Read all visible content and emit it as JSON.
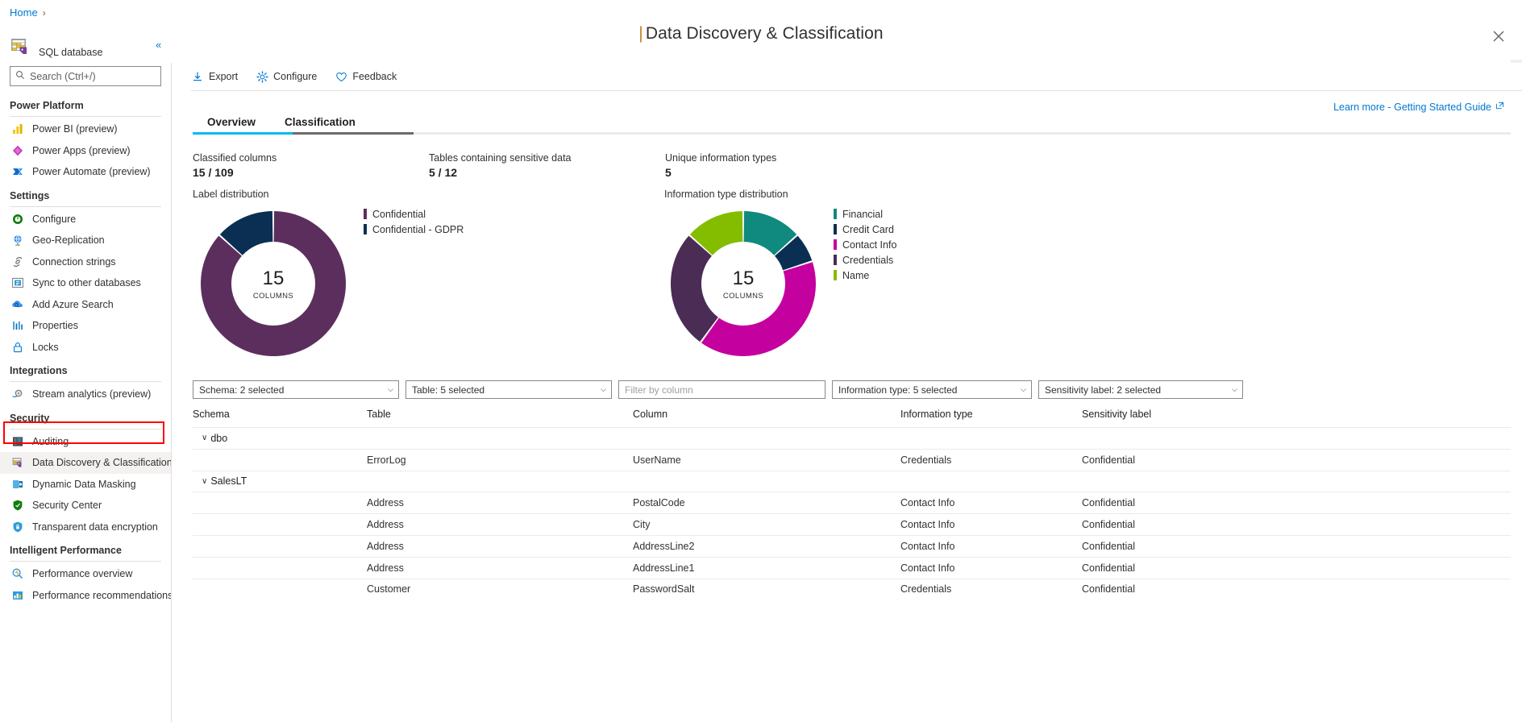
{
  "breadcrumb": {
    "home": "Home",
    "separator": "›"
  },
  "header": {
    "title": "Data Discovery & Classification",
    "title_pipe": "|",
    "close_icon": "close-icon"
  },
  "sidebar": {
    "resource_type": "SQL database",
    "resource_icon": "sql-database-icon",
    "search": {
      "placeholder": "Search (Ctrl+/)",
      "value": "",
      "icon": "search-icon"
    },
    "collapse_icon": "«",
    "groups": [
      {
        "title": "Power Platform",
        "items": [
          {
            "label": "Power BI (preview)",
            "icon": "power-bi-icon",
            "selected": false
          },
          {
            "label": "Power Apps (preview)",
            "icon": "power-apps-icon",
            "selected": false
          },
          {
            "label": "Power Automate (preview)",
            "icon": "power-automate-icon",
            "selected": false
          }
        ]
      },
      {
        "title": "Settings",
        "items": [
          {
            "label": "Configure",
            "icon": "configure-icon",
            "selected": false
          },
          {
            "label": "Geo-Replication",
            "icon": "globe-icon",
            "selected": false
          },
          {
            "label": "Connection strings",
            "icon": "plug-icon",
            "selected": false
          },
          {
            "label": "Sync to other databases",
            "icon": "sync-icon",
            "selected": false
          },
          {
            "label": "Add Azure Search",
            "icon": "cloud-search-icon",
            "selected": false
          },
          {
            "label": "Properties",
            "icon": "properties-icon",
            "selected": false
          },
          {
            "label": "Locks",
            "icon": "lock-icon",
            "selected": false
          }
        ]
      },
      {
        "title": "Integrations",
        "items": [
          {
            "label": "Stream analytics (preview)",
            "icon": "stream-analytics-icon",
            "selected": false
          }
        ]
      },
      {
        "title": "Security",
        "items": [
          {
            "label": "Auditing",
            "icon": "auditing-icon",
            "selected": false
          },
          {
            "label": "Data Discovery & Classification",
            "icon": "data-classification-icon",
            "selected": true
          },
          {
            "label": "Dynamic Data Masking",
            "icon": "data-masking-icon",
            "selected": false
          },
          {
            "label": "Security Center",
            "icon": "shield-green-icon",
            "selected": false
          },
          {
            "label": "Transparent data encryption",
            "icon": "shield-blue-icon",
            "selected": false
          }
        ]
      },
      {
        "title": "Intelligent Performance",
        "items": [
          {
            "label": "Performance overview",
            "icon": "performance-overview-icon",
            "selected": false
          },
          {
            "label": "Performance recommendations",
            "icon": "performance-recommendations-icon",
            "selected": false
          }
        ]
      }
    ]
  },
  "toolbar": {
    "export": {
      "label": "Export",
      "icon": "download-icon"
    },
    "configure": {
      "label": "Configure",
      "icon": "gear-icon"
    },
    "feedback": {
      "label": "Feedback",
      "icon": "heart-icon"
    },
    "learn_more": {
      "label": "Learn more - Getting Started Guide",
      "icon": "external-link-icon"
    }
  },
  "tabs": [
    {
      "label": "Overview",
      "active": true
    },
    {
      "label": "Classification",
      "active": false
    }
  ],
  "stats": [
    {
      "label": "Classified columns",
      "value": "15 / 109"
    },
    {
      "label": "Tables containing sensitive data",
      "value": "5 / 12"
    },
    {
      "label": "Unique information types",
      "value": "5"
    }
  ],
  "chart_data": [
    {
      "type": "pie",
      "title": "Label distribution",
      "center_value": "15",
      "center_label": "COLUMNS",
      "legend_position": "right",
      "categories": [
        "Confidential",
        "Confidential - GDPR"
      ],
      "values": [
        13,
        2
      ],
      "colors": [
        "#5C2E5E",
        "#0B2F52"
      ]
    },
    {
      "type": "pie",
      "title": "Information type distribution",
      "center_value": "15",
      "center_label": "COLUMNS",
      "legend_position": "right",
      "categories": [
        "Financial",
        "Credit Card",
        "Contact Info",
        "Credentials",
        "Name"
      ],
      "values": [
        2,
        1,
        6,
        4,
        2
      ],
      "colors": [
        "#10897E",
        "#0B2F52",
        "#C4009F",
        "#4A2C55",
        "#84BD00"
      ]
    }
  ],
  "filters": [
    {
      "name": "schema",
      "label": "Schema: 2 selected",
      "type": "select"
    },
    {
      "name": "table",
      "label": "Table: 5 selected",
      "type": "select"
    },
    {
      "name": "column",
      "placeholder": "Filter by column",
      "value": "",
      "type": "input"
    },
    {
      "name": "information-type",
      "label": "Information type: 5 selected",
      "type": "select"
    },
    {
      "name": "sensitivity-label",
      "label": "Sensitivity label: 2 selected",
      "type": "select"
    }
  ],
  "table": {
    "columns": [
      "Schema",
      "Table",
      "Column",
      "Information type",
      "Sensitivity label"
    ],
    "rows": [
      {
        "kind": "group",
        "schema": "dbo",
        "expanded": true
      },
      {
        "kind": "data",
        "schema": "",
        "table": "ErrorLog",
        "column": "UserName",
        "info_type": "Credentials",
        "sensitivity": "Confidential"
      },
      {
        "kind": "group",
        "schema": "SalesLT",
        "expanded": true
      },
      {
        "kind": "data",
        "schema": "",
        "table": "Address",
        "column": "PostalCode",
        "info_type": "Contact Info",
        "sensitivity": "Confidential"
      },
      {
        "kind": "data",
        "schema": "",
        "table": "Address",
        "column": "City",
        "info_type": "Contact Info",
        "sensitivity": "Confidential"
      },
      {
        "kind": "data",
        "schema": "",
        "table": "Address",
        "column": "AddressLine2",
        "info_type": "Contact Info",
        "sensitivity": "Confidential"
      },
      {
        "kind": "data",
        "schema": "",
        "table": "Address",
        "column": "AddressLine1",
        "info_type": "Contact Info",
        "sensitivity": "Confidential"
      },
      {
        "kind": "data",
        "schema": "",
        "table": "Customer",
        "column": "PasswordSalt",
        "info_type": "Credentials",
        "sensitivity": "Confidential"
      }
    ],
    "expand_chevron": "∨"
  },
  "colors": {
    "accent": "#0078d4",
    "tab_active": "#00bcf2",
    "tab_hover": "#6b6b6b",
    "highlight_box": "#ff0000",
    "title_pipe": "#c87d2a"
  }
}
